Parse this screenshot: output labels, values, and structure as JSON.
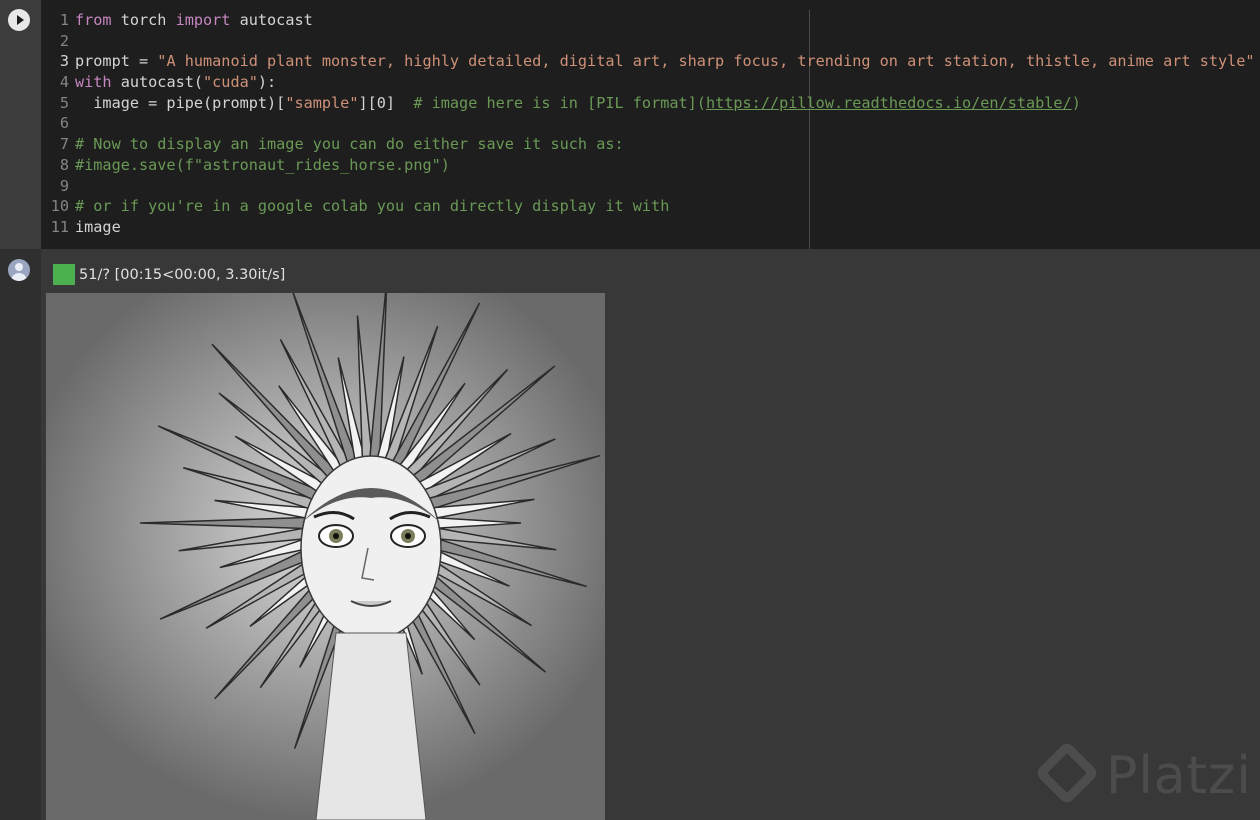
{
  "cell": {
    "run_icon": "play-icon",
    "lines": [
      {
        "n": "1",
        "active": false,
        "tokens": [
          {
            "t": "kw",
            "v": "from"
          },
          {
            "t": "pl",
            "v": " torch "
          },
          {
            "t": "kw",
            "v": "import"
          },
          {
            "t": "pl",
            "v": " autocast"
          }
        ]
      },
      {
        "n": "2",
        "active": false,
        "tokens": []
      },
      {
        "n": "3",
        "active": true,
        "tokens": [
          {
            "t": "pl",
            "v": "prompt = "
          },
          {
            "t": "str",
            "v": "\"A humanoid plant monster, highly detailed, digital art, sharp focus, trending on art station, thistle, anime art style\""
          }
        ]
      },
      {
        "n": "4",
        "active": false,
        "tokens": [
          {
            "t": "kw",
            "v": "with"
          },
          {
            "t": "pl",
            "v": " autocast("
          },
          {
            "t": "str",
            "v": "\"cuda\""
          },
          {
            "t": "pl",
            "v": "):"
          }
        ]
      },
      {
        "n": "5",
        "active": false,
        "tokens": [
          {
            "t": "pl",
            "v": "  image = pipe(prompt)["
          },
          {
            "t": "str",
            "v": "\"sample\""
          },
          {
            "t": "pl",
            "v": "][0]  "
          },
          {
            "t": "cm",
            "v": "# image here is in [PIL format]("
          },
          {
            "t": "lnk",
            "v": "https://pillow.readthedocs.io/en/stable/"
          },
          {
            "t": "cm",
            "v": ")"
          }
        ]
      },
      {
        "n": "6",
        "active": false,
        "tokens": []
      },
      {
        "n": "7",
        "active": false,
        "tokens": [
          {
            "t": "cm",
            "v": "# Now to display an image you can do either save it such as:"
          }
        ]
      },
      {
        "n": "8",
        "active": false,
        "tokens": [
          {
            "t": "cm",
            "v": "#image.save(f\"astronaut_rides_horse.png\")"
          }
        ]
      },
      {
        "n": "9",
        "active": false,
        "tokens": []
      },
      {
        "n": "10",
        "active": false,
        "tokens": [
          {
            "t": "cm",
            "v": "# or if you're in a google colab you can directly display it with"
          }
        ]
      },
      {
        "n": "11",
        "active": false,
        "tokens": [
          {
            "t": "pl",
            "v": "image"
          }
        ]
      }
    ]
  },
  "output": {
    "avatar_icon": "user-avatar-icon",
    "progress": {
      "fraction": 1.0,
      "text": "51/? [00:15<00:00, 3.30it/s]",
      "color": "#4caf50"
    },
    "image_subject": "humanoid-plant-monster-image"
  },
  "watermark": {
    "text": "Platzi"
  },
  "colors": {
    "editor_bg": "#1e1e1e",
    "keyword": "#c586c0",
    "string": "#ce9178",
    "comment": "#6a9955",
    "output_bg": "#383838"
  }
}
